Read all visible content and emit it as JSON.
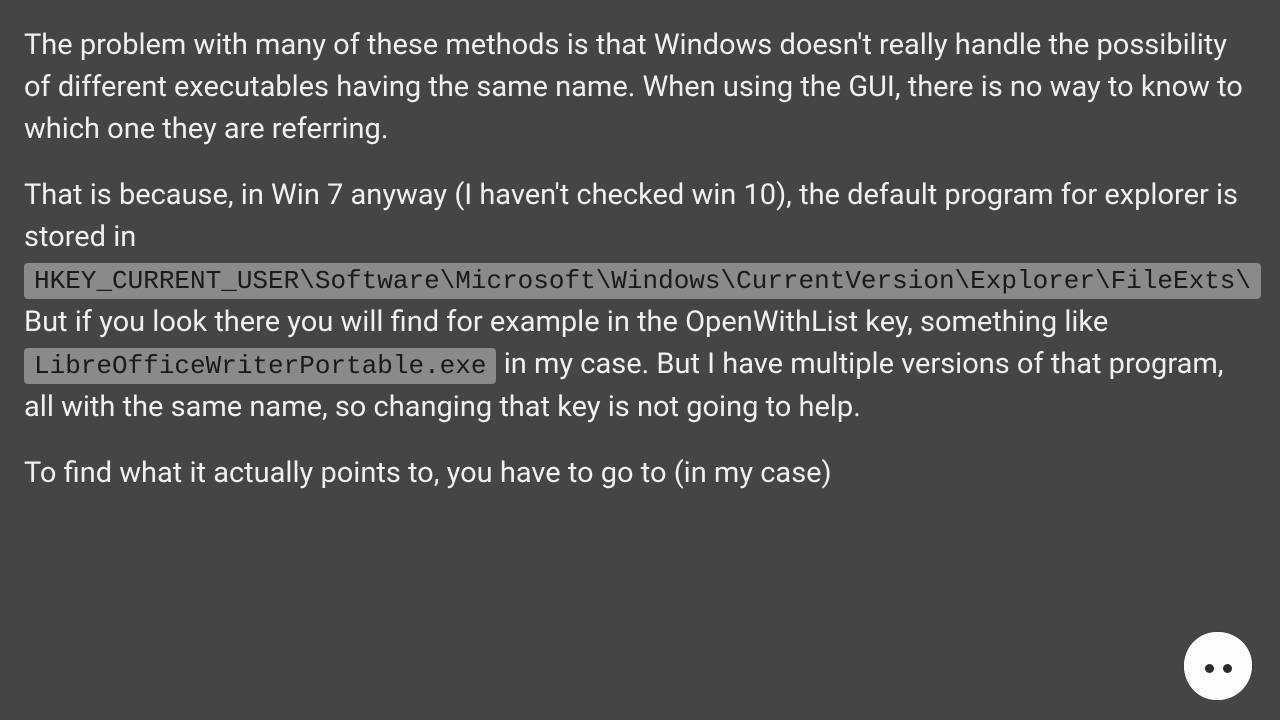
{
  "paragraphs": {
    "p1": "The problem with many of these methods is that Windows doesn't really handle the possibility of different executables having the same name. When using the GUI, there is no way to know to which one they are referring.",
    "p2_a": "That is because, in Win 7 anyway (I haven't checked win 10), the default program for explorer is stored in ",
    "p2_code1": "HKEY_CURRENT_USER\\Software\\Microsoft\\Windows\\CurrentVersion\\Explorer\\FileExts\\",
    "p2_b": " But if you look there you will find for example in the OpenWithList key, something like ",
    "p2_code2": "LibreOfficeWriterPortable.exe",
    "p2_c": " in my case. But I have multiple versions of that program, all with the same name, so changing that key is not going to help.",
    "p3": "To find what it actually points to, you have to go to (in my case)"
  }
}
